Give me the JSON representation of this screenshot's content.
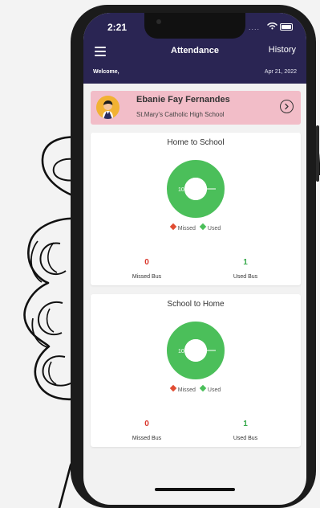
{
  "status_bar": {
    "time": "2:21",
    "dots": "....",
    "wifi_icon": "wifi-icon",
    "battery_icon": "battery-icon"
  },
  "header": {
    "title": "Attendance",
    "history_label": "History",
    "welcome": "Welcome,",
    "date": "Apr 21, 2022",
    "menu_icon": "hamburger-menu-icon",
    "background": "#2a2553"
  },
  "student": {
    "name": "Ebanie Fay Fernandes",
    "school": "St.Mary's Catholic High School",
    "card_color": "#f2bdc8",
    "avatar_icon": "student-avatar-icon",
    "chevron_icon": "chevron-right-icon"
  },
  "sections": [
    {
      "title": "Home to School",
      "chart_label": "100%",
      "legend": {
        "missed": "Missed",
        "used": "Used"
      },
      "missed_value": "0",
      "used_value": "1",
      "missed_label": "Missed Bus",
      "used_label": "Used Bus"
    },
    {
      "title": "School to Home",
      "chart_label": "100%",
      "legend": {
        "missed": "Missed",
        "used": "Used"
      },
      "missed_value": "0",
      "used_value": "1",
      "missed_label": "Missed Bus",
      "used_label": "Used Bus"
    }
  ],
  "colors": {
    "used": "#4bbf5a",
    "missed": "#e14d33",
    "used_text": "#35a94a",
    "missed_text": "#d9352a"
  },
  "chart_data": [
    {
      "type": "pie",
      "title": "Home to School",
      "categories": [
        "Missed",
        "Used"
      ],
      "values": [
        0,
        100
      ]
    },
    {
      "type": "pie",
      "title": "School to Home",
      "categories": [
        "Missed",
        "Used"
      ],
      "values": [
        0,
        100
      ]
    }
  ]
}
